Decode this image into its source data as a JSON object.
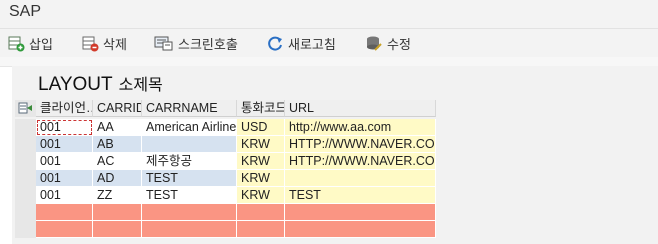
{
  "app": {
    "title": "SAP"
  },
  "toolbar": {
    "insert": "삽입",
    "delete": "삭제",
    "screen_call": "스크린호출",
    "refresh": "새로고침",
    "edit": "수정"
  },
  "layout": {
    "title": "LAYOUT",
    "subtitle": "소제목"
  },
  "table": {
    "headers": [
      "클라이언…",
      "CARRID",
      "CARRNAME",
      "통화코드",
      "URL"
    ],
    "rows": [
      {
        "cells": [
          "001",
          "AA",
          "American Airlines",
          "USD",
          "http://www.aa.com"
        ],
        "shade": "white"
      },
      {
        "cells": [
          "001",
          "AB",
          "",
          "KRW",
          "HTTP://WWW.NAVER.COM"
        ],
        "shade": "blue"
      },
      {
        "cells": [
          "001",
          "AC",
          "제주항공",
          "KRW",
          "HTTP://WWW.NAVER.COM"
        ],
        "shade": "white"
      },
      {
        "cells": [
          "001",
          "AD",
          "TEST",
          "KRW",
          ""
        ],
        "shade": "blue"
      },
      {
        "cells": [
          "001",
          "ZZ",
          "TEST",
          "KRW",
          "TEST"
        ],
        "shade": "white"
      },
      {
        "cells": [
          "",
          "",
          "",
          "",
          ""
        ],
        "shade": "red"
      },
      {
        "cells": [
          "",
          "",
          "",
          "",
          ""
        ],
        "shade": "red"
      }
    ]
  },
  "colors": {
    "row_white": "#ffffff",
    "row_blue": "#d6e2f0",
    "currency_yellow": "#fffac6",
    "new_row_red": "#fa9583"
  }
}
